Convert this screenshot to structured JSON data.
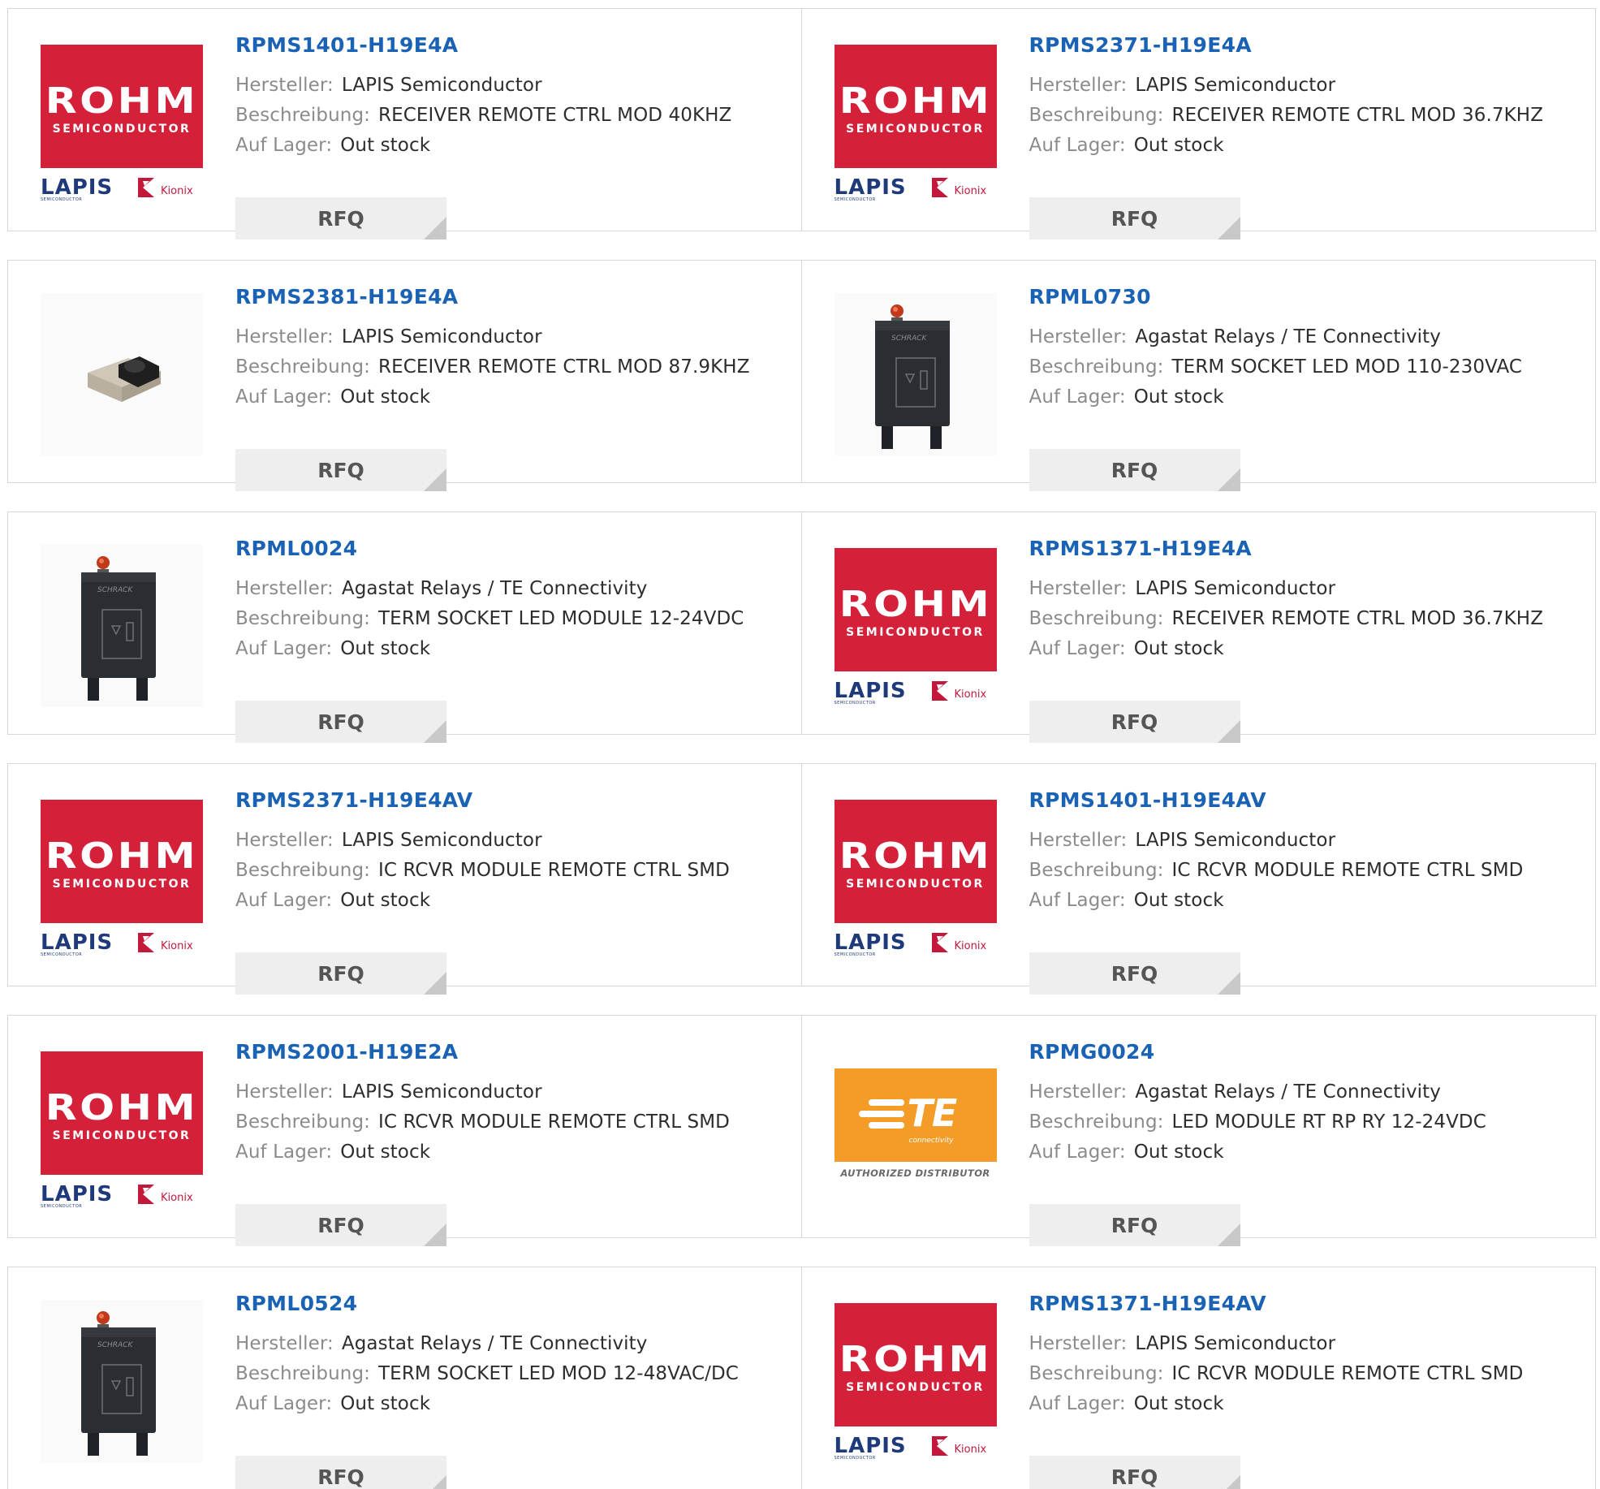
{
  "labels": {
    "manufacturer": "Hersteller:",
    "description": "Beschreibung:",
    "stock": "Auf Lager:",
    "rfq": "RFQ"
  },
  "logos": {
    "rohm_main": "ROHM",
    "rohm_sub": "SEMICONDUCTOR",
    "lapis": "LAPIS",
    "lapis_sub": "SEMICONDUCTOR",
    "kionix": "Kionix",
    "te_main": "TE",
    "te_sub": "connectivity",
    "te_auth": "AUTHORIZED DISTRIBUTOR"
  },
  "colors": {
    "link": "#1a62b3",
    "rohm_red": "#d5203a",
    "te_orange": "#f39c27",
    "button_bg": "#eeeeee"
  },
  "products": [
    {
      "part": "RPMS1401-H19E4A",
      "manufacturer": "LAPIS Semiconductor",
      "description": "RECEIVER REMOTE CTRL MOD 40KHZ",
      "stock": "Out stock",
      "image": "rohm-logo"
    },
    {
      "part": "RPMS2371-H19E4A",
      "manufacturer": "LAPIS Semiconductor",
      "description": "RECEIVER REMOTE CTRL MOD 36.7KHZ",
      "stock": "Out stock",
      "image": "rohm-logo"
    },
    {
      "part": "RPMS2381-H19E4A",
      "manufacturer": "LAPIS Semiconductor",
      "description": "RECEIVER REMOTE CTRL MOD 87.9KHZ",
      "stock": "Out stock",
      "image": "receiver-module-photo"
    },
    {
      "part": "RPML0730",
      "manufacturer": "Agastat Relays / TE Connectivity",
      "description": "TERM SOCKET LED MOD 110-230VAC",
      "stock": "Out stock",
      "image": "led-module-photo"
    },
    {
      "part": "RPML0024",
      "manufacturer": "Agastat Relays / TE Connectivity",
      "description": "TERM SOCKET LED MODULE 12-24VDC",
      "stock": "Out stock",
      "image": "led-module-photo"
    },
    {
      "part": "RPMS1371-H19E4A",
      "manufacturer": "LAPIS Semiconductor",
      "description": "RECEIVER REMOTE CTRL MOD 36.7KHZ",
      "stock": "Out stock",
      "image": "rohm-logo"
    },
    {
      "part": "RPMS2371-H19E4AV",
      "manufacturer": "LAPIS Semiconductor",
      "description": "IC RCVR MODULE REMOTE CTRL SMD",
      "stock": "Out stock",
      "image": "rohm-logo"
    },
    {
      "part": "RPMS1401-H19E4AV",
      "manufacturer": "LAPIS Semiconductor",
      "description": "IC RCVR MODULE REMOTE CTRL SMD",
      "stock": "Out stock",
      "image": "rohm-logo"
    },
    {
      "part": "RPMS2001-H19E2A",
      "manufacturer": "LAPIS Semiconductor",
      "description": "IC RCVR MODULE REMOTE CTRL SMD",
      "stock": "Out stock",
      "image": "rohm-logo"
    },
    {
      "part": "RPMG0024",
      "manufacturer": "Agastat Relays / TE Connectivity",
      "description": "LED MODULE RT RP RY 12-24VDC",
      "stock": "Out stock",
      "image": "te-logo"
    },
    {
      "part": "RPML0524",
      "manufacturer": "Agastat Relays / TE Connectivity",
      "description": "TERM SOCKET LED MOD 12-48VAC/DC",
      "stock": "Out stock",
      "image": "led-module-photo"
    },
    {
      "part": "RPMS1371-H19E4AV",
      "manufacturer": "LAPIS Semiconductor",
      "description": "IC RCVR MODULE REMOTE CTRL SMD",
      "stock": "Out stock",
      "image": "rohm-logo"
    }
  ]
}
